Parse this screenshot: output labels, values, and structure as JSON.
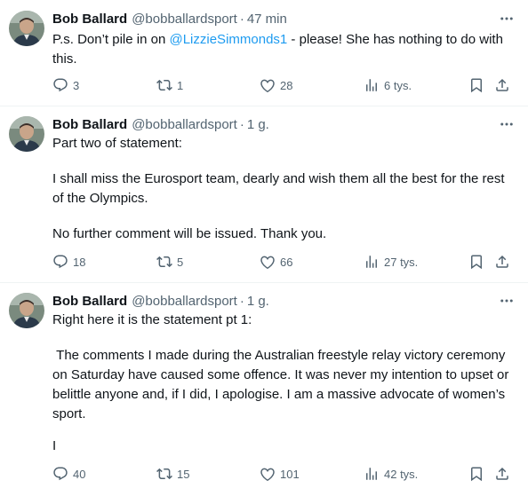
{
  "colors": {
    "text": "#0f1419",
    "secondary": "#536471",
    "link": "#1d9bf0",
    "divider": "#eff3f4"
  },
  "tweets": [
    {
      "author_name": "Bob Ballard",
      "handle": "@bobballardsport",
      "separator": "·",
      "time": "47 min",
      "text_before": "P.s. Don’t pile in on ",
      "mention": "@LizzieSimmonds1",
      "text_after": " - please! She has nothing to do with this.",
      "replies": "3",
      "reposts": "1",
      "likes": "28",
      "views": "6 tys."
    },
    {
      "author_name": "Bob Ballard",
      "handle": "@bobballardsport",
      "separator": "·",
      "time": "1 g.",
      "paragraphs": [
        "Part two of statement:",
        "I shall miss the Eurosport team, dearly and wish them all the best for the rest of the Olympics.",
        "No further comment will be issued. Thank you."
      ],
      "replies": "18",
      "reposts": "5",
      "likes": "66",
      "views": "27 tys."
    },
    {
      "author_name": "Bob Ballard",
      "handle": "@bobballardsport",
      "separator": "·",
      "time": "1 g.",
      "paragraphs": [
        "Right here it is the statement pt 1:",
        " The comments I made during the Australian freestyle relay victory ceremony on Saturday have caused some offence. It was never my intention to upset or belittle anyone and, if I did, I apologise. I am a massive advocate of women’s sport.",
        "I"
      ],
      "replies": "40",
      "reposts": "15",
      "likes": "101",
      "views": "42 tys."
    }
  ]
}
